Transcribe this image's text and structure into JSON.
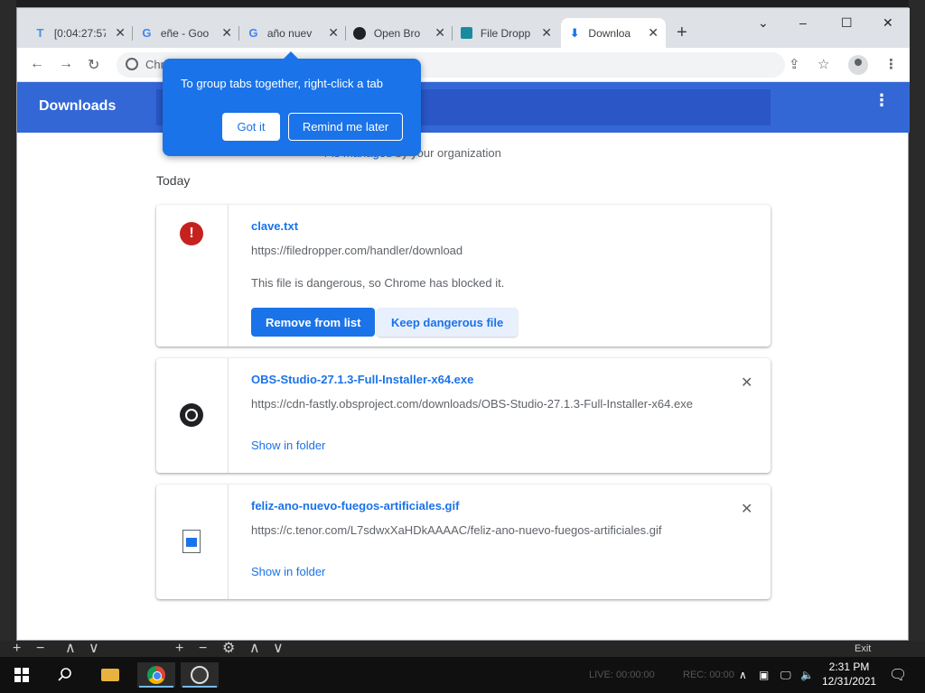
{
  "tabs": [
    {
      "title": "[0:04:27:57",
      "favicon": "T",
      "active": false
    },
    {
      "title": "eñe - Goo",
      "favicon": "G",
      "active": false
    },
    {
      "title": "año nuev",
      "favicon": "G",
      "active": false
    },
    {
      "title": "Open Bro",
      "favicon": "obs-icon",
      "active": false
    },
    {
      "title": "File Dropp",
      "favicon": "file-dropper-icon",
      "active": false
    },
    {
      "title": "Downloa",
      "favicon": "download-icon",
      "active": true
    }
  ],
  "tab_close": "✕",
  "new_tab": "+",
  "window_controls": {
    "minimize": "–",
    "maximize": "☐",
    "close": "✕",
    "tab_search": "⌄"
  },
  "toolbar": {
    "url_fragment": "Chr"
  },
  "downloads": {
    "title": "Downloads",
    "managed_prefix": "r ",
    "managed_link": "is managed",
    "managed_suffix": " by your organization",
    "section": "Today",
    "items": [
      {
        "name": "clave.txt",
        "url": "https://filedropper.com/handler/download",
        "message": "This file is dangerous, so Chrome has blocked it.",
        "primary_action": "Remove from list",
        "secondary_action": "Keep dangerous file",
        "icon": "danger-icon"
      },
      {
        "name": "OBS-Studio-27.1.3-Full-Installer-x64.exe",
        "url": "https://cdn-fastly.obsproject.com/downloads/OBS-Studio-27.1.3-Full-Installer-x64.exe",
        "action": "Show in folder",
        "icon": "obs-icon"
      },
      {
        "name": "feliz-ano-nuevo-fuegos-artificiales.gif",
        "url": "https://c.tenor.com/L7sdwxXaHDkAAAAC/feliz-ano-nuevo-fuegos-artificiales.gif",
        "action": "Show in folder",
        "icon": "image-file-icon"
      }
    ]
  },
  "bubble": {
    "message": "To group tabs together, right-click a tab",
    "got_it": "Got it",
    "remind_later": "Remind me later"
  },
  "taskbar": {
    "time": "2:31 PM",
    "date": "12/31/2021",
    "live": "LIVE: 00:00:00",
    "rec": "REC: 00:00"
  },
  "obs": {
    "exit": "Exit"
  }
}
